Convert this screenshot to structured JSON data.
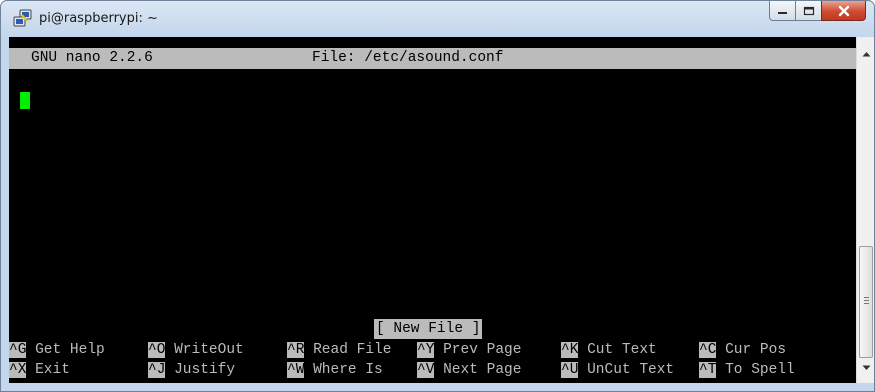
{
  "window": {
    "title": "pi@raspberrypi: ~",
    "app_icon": "putty-icon"
  },
  "nano": {
    "version": "GNU nano 2.2.6",
    "file_label": "File: /etc/asound.conf",
    "status": "[ New File ]",
    "shortcuts": [
      [
        {
          "key": "^G",
          "label": " Get Help"
        },
        {
          "key": "^O",
          "label": " WriteOut"
        },
        {
          "key": "^R",
          "label": " Read File"
        },
        {
          "key": "^Y",
          "label": " Prev Page"
        },
        {
          "key": "^K",
          "label": " Cut Text"
        },
        {
          "key": "^C",
          "label": " Cur Pos"
        }
      ],
      [
        {
          "key": "^X",
          "label": " Exit"
        },
        {
          "key": "^J",
          "label": " Justify"
        },
        {
          "key": "^W",
          "label": " Where Is"
        },
        {
          "key": "^V",
          "label": " Next Page"
        },
        {
          "key": "^U",
          "label": " UnCut Text"
        },
        {
          "key": "^T",
          "label": " To Spell"
        }
      ]
    ]
  },
  "colors": {
    "terminal_bg": "#000000",
    "header_bg": "#bbbbbb",
    "cursor": "#00ee00",
    "close_button": "#c7432a"
  }
}
